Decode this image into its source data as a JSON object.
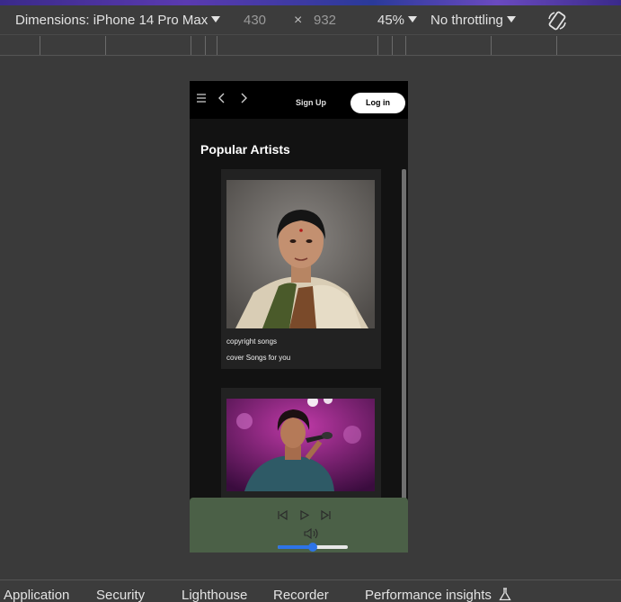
{
  "devtools": {
    "dimensions_label": "Dimensions: iPhone 14 Pro Max",
    "width": "430",
    "times": "×",
    "height": "932",
    "zoom": "45%",
    "throttling": "No throttling"
  },
  "app": {
    "header": {
      "menu_icon": "menu-icon",
      "back_icon": "chevron-left-icon",
      "forward_icon": "chevron-right-icon",
      "signup_label": "Sign Up",
      "login_label": "Log in"
    },
    "section_title": "Popular Artists",
    "cards": [
      {
        "line1": "copyright songs",
        "line2": "cover Songs for you"
      },
      {
        "line1": "",
        "line2": ""
      }
    ],
    "player": {
      "prev_icon": "skip-back-icon",
      "play_icon": "play-icon",
      "next_icon": "skip-forward-icon",
      "volume_icon": "volume-icon",
      "volume_level": 0.5,
      "accent": "#2d74e8",
      "background": "#4b6047"
    }
  },
  "bottom_tabs": [
    "Application",
    "Security",
    "Lighthouse",
    "Recorder",
    "Performance insights"
  ]
}
